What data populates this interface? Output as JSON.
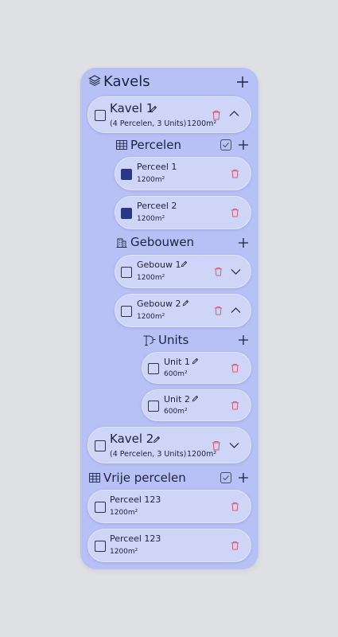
{
  "header": {
    "title": "Kavels"
  },
  "kavels": [
    {
      "name": "Kavel 1",
      "summary": "(4 Percelen, 3 Units)",
      "area": "1200m²"
    },
    {
      "name": "Kavel 2",
      "summary": "(4 Percelen, 3 Units)",
      "area": "1200m²"
    }
  ],
  "percelen": {
    "title": "Percelen",
    "items": [
      {
        "name": "Perceel 1",
        "area": "1200m²"
      },
      {
        "name": "Perceel 2",
        "area": "1200m²"
      }
    ]
  },
  "gebouwen": {
    "title": "Gebouwen",
    "items": [
      {
        "name": "Gebouw 1",
        "area": "1200m²"
      },
      {
        "name": "Gebouw 2",
        "area": "1200m²"
      }
    ]
  },
  "units": {
    "title": "Units",
    "items": [
      {
        "name": "Unit 1",
        "area": "600m²"
      },
      {
        "name": "Unit 2",
        "area": "600m²"
      }
    ]
  },
  "vrije_percelen": {
    "title": "Vrije percelen",
    "items": [
      {
        "name": "Perceel 123",
        "area": "1200m²"
      },
      {
        "name": "Perceel 123",
        "area": "1200m²"
      }
    ]
  },
  "colors": {
    "panel": "#b7c1f6",
    "card": "#ced5f6",
    "selected_checkbox": "#2a3786",
    "delete_icon": "#d9506a"
  },
  "icons": [
    "layers-icon",
    "add-icon",
    "edit-icon",
    "trash-icon",
    "chevron-up-icon",
    "chevron-down-icon",
    "grid-icon",
    "building-icon",
    "units-icon",
    "select-all-icon"
  ]
}
